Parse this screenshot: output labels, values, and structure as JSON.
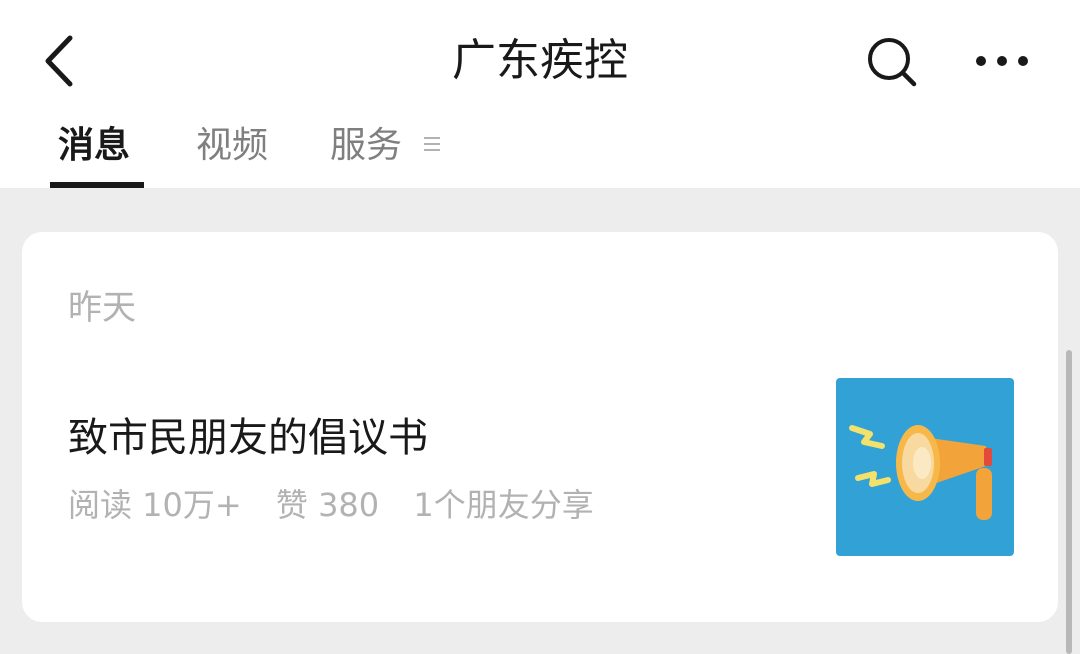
{
  "header": {
    "title": "广东疾控",
    "back_icon": "chevron-left-icon",
    "search_icon": "search-icon",
    "more_icon": "more-dots-icon"
  },
  "tabs": [
    {
      "label": "消息",
      "active": true
    },
    {
      "label": "视频",
      "active": false
    },
    {
      "label": "服务",
      "active": false,
      "icon": "menu-icon"
    }
  ],
  "feed": {
    "date_label": "昨天",
    "article": {
      "title": "致市民朋友的倡议书",
      "reads": "阅读 10万+",
      "likes": "赞 380",
      "shares": "1个朋友分享",
      "thumbnail_icon": "megaphone-icon",
      "thumbnail_bg": "#31a1d6"
    }
  },
  "colors": {
    "background": "#ededed",
    "text_primary": "#191919",
    "text_secondary": "#b2b2b2",
    "tab_inactive": "#7f7f7f"
  }
}
